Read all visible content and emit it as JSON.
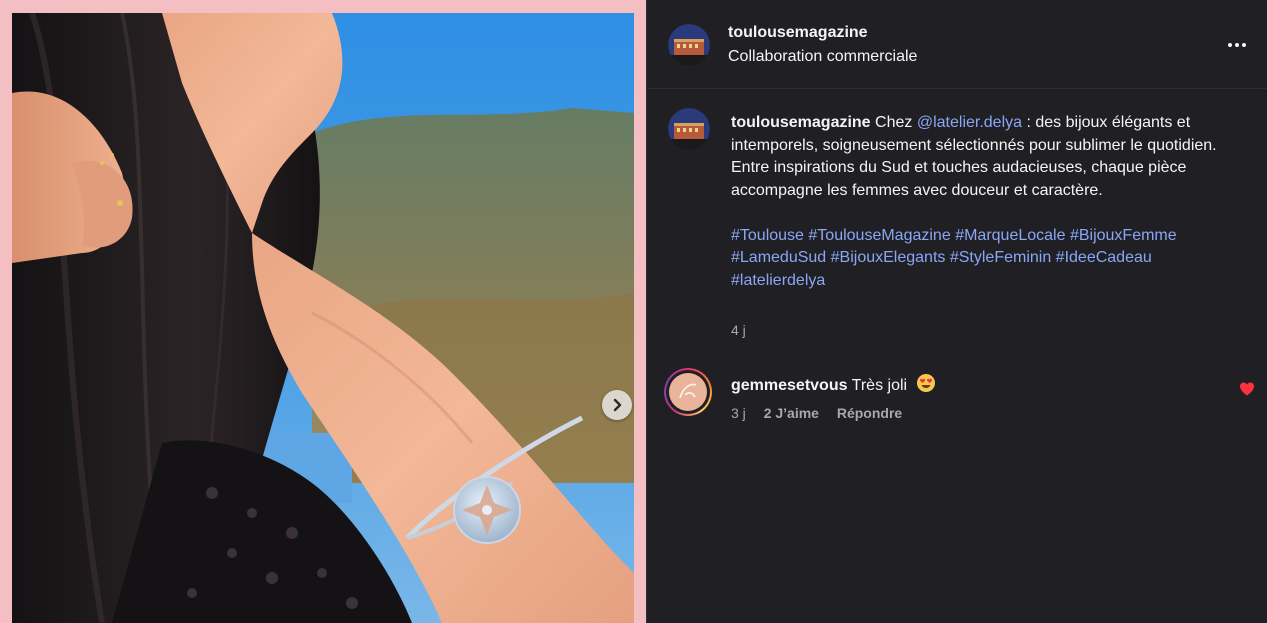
{
  "post": {
    "author": "toulousemagazine",
    "subtitle": "Collaboration commerciale",
    "more_icon": "more-horizontal-icon"
  },
  "caption": {
    "author": "toulousemagazine",
    "text_intro": "Chez",
    "mention": "@latelier.delya",
    "text_1": " : des bijoux élégants et intemporels, soigneusement sélectionnés pour sublimer le quotidien.",
    "text_2": "Entre inspirations du Sud et touches audacieuses, chaque pièce accompagne les femmes avec douceur et caractère.",
    "hashtags": [
      "#Toulouse",
      "#ToulouseMagazine",
      "#MarqueLocale",
      "#BijouxFemme",
      "#LameduSud",
      "#BijouxElegants",
      "#StyleFeminin",
      "#IdeeCadeau",
      "#latelierdelya"
    ],
    "time": "4 j"
  },
  "comment": {
    "author": "gemmesetvous",
    "text": "Très joli",
    "emoji": "heart-eyes-emoji",
    "time": "3 j",
    "likes": "2 J’aime",
    "reply": "Répondre",
    "liked": true
  },
  "media": {
    "next_icon": "chevron-right-icon"
  },
  "colors": {
    "panel_bg": "#202024",
    "link": "#8aa6f5",
    "frame": "#f4bfc3",
    "like_heart": "#ff3040"
  }
}
